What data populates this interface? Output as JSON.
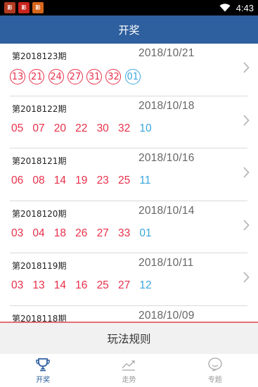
{
  "status_bar": {
    "time": "4:43",
    "app_icons": [
      "app-icon-1",
      "app-icon-2",
      "app-icon-3"
    ],
    "wifi_icon": "wifi-icon"
  },
  "header": {
    "title": "开奖"
  },
  "draws": [
    {
      "issue": "第2018123期",
      "date": "2018/10/21",
      "red": [
        "13",
        "21",
        "24",
        "27",
        "31",
        "32"
      ],
      "blue": "01"
    },
    {
      "issue": "第2018122期",
      "date": "2018/10/18",
      "red": [
        "05",
        "07",
        "20",
        "22",
        "30",
        "32"
      ],
      "blue": "10"
    },
    {
      "issue": "第2018121期",
      "date": "2018/10/16",
      "red": [
        "06",
        "08",
        "14",
        "19",
        "23",
        "25"
      ],
      "blue": "11"
    },
    {
      "issue": "第2018120期",
      "date": "2018/10/14",
      "red": [
        "03",
        "04",
        "18",
        "26",
        "27",
        "33"
      ],
      "blue": "01"
    },
    {
      "issue": "第2018119期",
      "date": "2018/10/11",
      "red": [
        "03",
        "13",
        "14",
        "16",
        "25",
        "27"
      ],
      "blue": "12"
    },
    {
      "issue": "第2018118期",
      "date": "2018/10/09",
      "red": [],
      "blue": ""
    }
  ],
  "rules_bar": {
    "label": "玩法规则"
  },
  "bottom_nav": [
    {
      "label": "开奖",
      "icon": "trophy-icon",
      "active": true
    },
    {
      "label": "走势",
      "icon": "trend-icon",
      "active": false
    },
    {
      "label": "专题",
      "icon": "chat-bubble-icon",
      "active": false
    }
  ],
  "colors": {
    "header": "#2e5f9e",
    "red_ball": "#e8304a",
    "blue_ball": "#3aa6dd"
  }
}
